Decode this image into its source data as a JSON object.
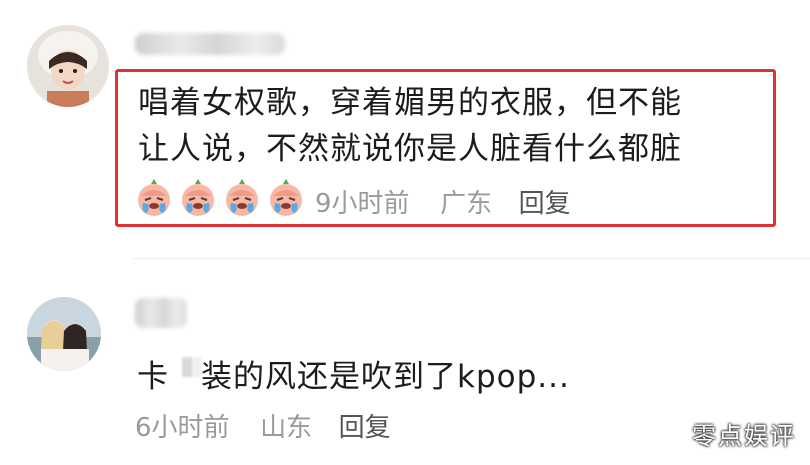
{
  "comments": [
    {
      "text_line1": "唱着女权歌，穿着媚男的衣服，但不能",
      "text_line2": "让人说，不然就说你是人脏看什么都脏",
      "emoji": "crying-face",
      "time": "9小时前",
      "location": "广东",
      "reply_label": "回复",
      "highlight_color": "#e03232"
    },
    {
      "text": "卡▒装的风还是吹到了kpop...",
      "text_prefix": "卡",
      "text_suffix": "装的风还是吹到了kpop...",
      "time": "6小时前",
      "location": "山东",
      "reply_label": "回复"
    }
  ],
  "watermark": "零点娱评"
}
